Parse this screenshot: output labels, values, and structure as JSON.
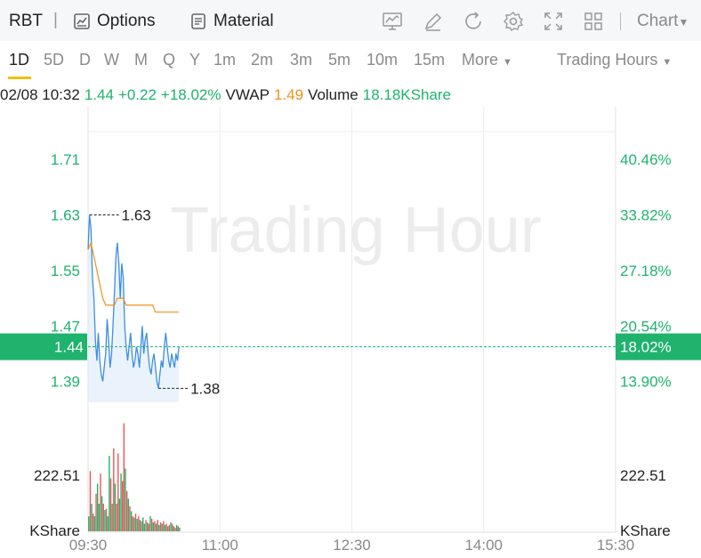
{
  "toolbar": {
    "ticker": "RBT",
    "separator": "|",
    "options_label": "Options",
    "material_label": "Material",
    "chart_label": "Chart",
    "tool_icons": [
      "indicator-icon",
      "draw-icon",
      "refresh-icon",
      "settings-icon",
      "fullscreen-icon",
      "layout-icon"
    ]
  },
  "timeframes": {
    "tabs": [
      "1D",
      "5D",
      "D",
      "W",
      "M",
      "Q",
      "Y",
      "1m",
      "2m",
      "3m",
      "5m",
      "10m",
      "15m"
    ],
    "selected": "1D",
    "more_label": "More",
    "hours_label": "Trading Hours"
  },
  "quote": {
    "datetime": "02/08 10:32",
    "price": "1.44",
    "change": "+0.22",
    "change_pct": "+18.02%",
    "vwap_label": "VWAP",
    "vwap_value": "1.49",
    "volume_label": "Volume",
    "volume_value": "18.18KShare"
  },
  "colors": {
    "up": "#1fb36e",
    "down": "#f05454",
    "price_line": "#3d8fe0",
    "vwap_line": "#f0901e",
    "accent": "#f0c000"
  },
  "chart_data": [
    {
      "type": "line",
      "watermark": "Trading Hour",
      "current_price": 1.44,
      "current_pct": "18.02%",
      "high": 1.63,
      "high_label": "1.63",
      "low": 1.38,
      "low_label": "1.38",
      "ylim": [
        1.36,
        1.75
      ],
      "y_ticks": [
        1.71,
        1.63,
        1.55,
        1.47,
        1.39
      ],
      "y_tick_labels": [
        "1.71",
        "1.63",
        "1.55",
        "1.47",
        "1.39"
      ],
      "pct_tick_labels": [
        "40.46%",
        "33.82%",
        "27.18%",
        "20.54%",
        "13.90%"
      ],
      "x_ticks": [
        "09:30",
        "11:00",
        "12:30",
        "14:00",
        "15:30"
      ],
      "x_tick_minutes": [
        0,
        90,
        180,
        270,
        360
      ],
      "xlim_minutes": [
        0,
        360
      ],
      "series": [
        {
          "minutes": [
            0,
            1,
            2,
            3,
            4,
            5,
            6,
            7,
            8,
            9,
            10,
            11,
            12,
            13,
            14,
            15,
            16,
            17,
            18,
            19,
            20,
            21,
            22,
            23,
            24,
            25,
            26,
            27,
            28,
            29,
            30,
            31,
            32,
            33,
            34,
            35,
            36,
            37,
            38,
            39,
            40,
            41,
            42,
            43,
            44,
            45,
            46,
            47,
            48,
            49,
            50,
            51,
            52,
            53,
            54,
            55,
            56,
            57,
            58,
            59,
            60,
            61,
            62
          ],
          "values": [
            1.58,
            1.63,
            1.61,
            1.54,
            1.51,
            1.45,
            1.42,
            1.46,
            1.42,
            1.4,
            1.39,
            1.41,
            1.43,
            1.48,
            1.45,
            1.41,
            1.43,
            1.47,
            1.52,
            1.57,
            1.59,
            1.56,
            1.51,
            1.56,
            1.54,
            1.47,
            1.44,
            1.42,
            1.44,
            1.46,
            1.43,
            1.41,
            1.42,
            1.44,
            1.43,
            1.41,
            1.44,
            1.47,
            1.43,
            1.45,
            1.46,
            1.43,
            1.41,
            1.4,
            1.42,
            1.43,
            1.41,
            1.39,
            1.38,
            1.4,
            1.42,
            1.41,
            1.44,
            1.46,
            1.44,
            1.42,
            1.41,
            1.43,
            1.42,
            1.41,
            1.43,
            1.42,
            1.44
          ]
        },
        {
          "minutes": [
            0,
            2,
            4,
            6,
            8,
            10,
            12,
            14,
            16,
            18,
            20,
            22,
            24,
            26,
            28,
            30,
            32,
            34,
            36,
            38,
            40,
            42,
            44,
            46,
            48,
            50,
            52,
            54,
            56,
            58,
            60,
            62
          ],
          "values": [
            1.58,
            1.59,
            1.57,
            1.55,
            1.53,
            1.51,
            1.5,
            1.5,
            1.5,
            1.5,
            1.51,
            1.51,
            1.51,
            1.5,
            1.5,
            1.5,
            1.5,
            1.5,
            1.5,
            1.5,
            1.5,
            1.5,
            1.5,
            1.49,
            1.49,
            1.49,
            1.49,
            1.49,
            1.49,
            1.49,
            1.49,
            1.49
          ]
        }
      ]
    },
    {
      "type": "bar",
      "y_label_left": "222.51",
      "y_unit_left": "KShare",
      "y_label_right": "222.51",
      "y_unit_right": "KShare",
      "reference_value": 222.51,
      "ylim": [
        0,
        450
      ],
      "minutes": [
        0,
        1,
        2,
        3,
        4,
        5,
        6,
        7,
        8,
        9,
        10,
        11,
        12,
        13,
        14,
        15,
        16,
        17,
        18,
        19,
        20,
        21,
        22,
        23,
        24,
        25,
        26,
        27,
        28,
        29,
        30,
        31,
        32,
        33,
        34,
        35,
        36,
        37,
        38,
        39,
        40,
        41,
        42,
        43,
        44,
        45,
        46,
        47,
        48,
        49,
        50,
        51,
        52,
        53,
        54,
        55,
        56,
        57,
        58,
        59,
        60,
        61,
        62
      ],
      "values": [
        60,
        240,
        110,
        70,
        60,
        150,
        190,
        110,
        230,
        140,
        110,
        85,
        90,
        60,
        300,
        210,
        110,
        330,
        190,
        110,
        310,
        130,
        230,
        200,
        430,
        250,
        160,
        130,
        100,
        80,
        60,
        55,
        70,
        50,
        60,
        45,
        40,
        55,
        30,
        45,
        35,
        30,
        60,
        50,
        35,
        40,
        30,
        45,
        25,
        35,
        30,
        40,
        25,
        30,
        20,
        25,
        35,
        30,
        20,
        15,
        25,
        20,
        15
      ],
      "directions": [
        "u",
        "d",
        "u",
        "d",
        "u",
        "d",
        "u",
        "u",
        "d",
        "u",
        "d",
        "u",
        "d",
        "u",
        "u",
        "d",
        "u",
        "d",
        "u",
        "d",
        "d",
        "u",
        "u",
        "d",
        "d",
        "u",
        "d",
        "u",
        "d",
        "u",
        "d",
        "u",
        "d",
        "u",
        "d",
        "u",
        "d",
        "u",
        "u",
        "d",
        "u",
        "d",
        "u",
        "d",
        "u",
        "d",
        "u",
        "d",
        "u",
        "d",
        "u",
        "d",
        "u",
        "d",
        "u",
        "d",
        "u",
        "d",
        "u",
        "d",
        "u",
        "d",
        "u"
      ]
    }
  ]
}
